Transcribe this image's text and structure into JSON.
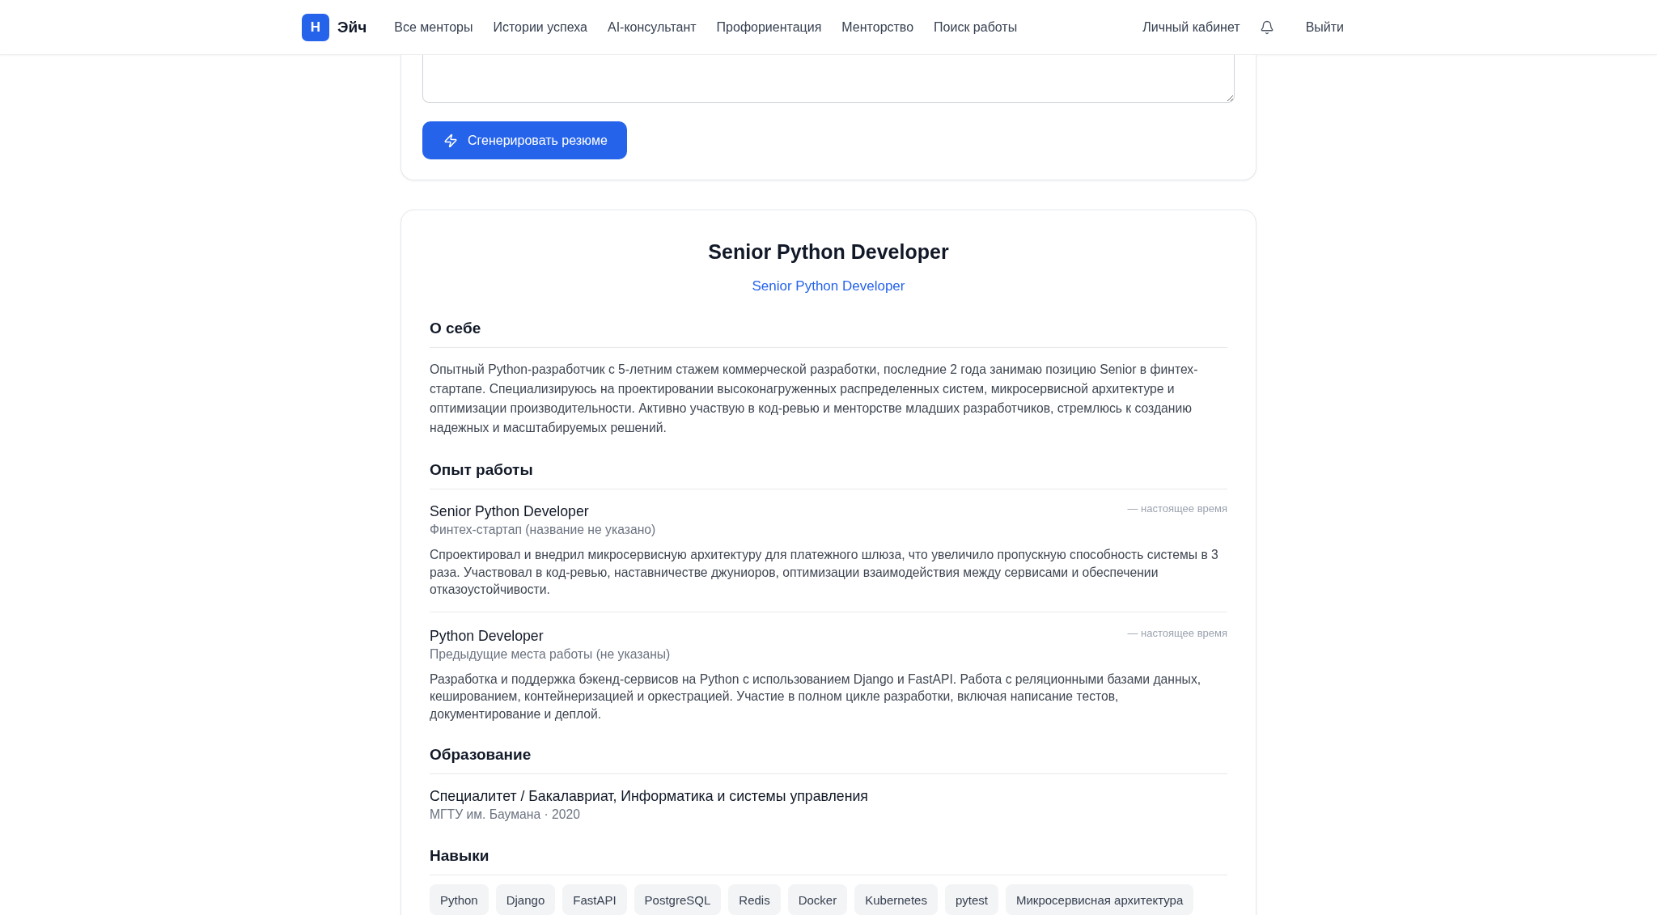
{
  "header": {
    "logo_mark": "H",
    "brand": "Эйч",
    "nav": [
      "Все менторы",
      "Истории успеха",
      "AI-консультант",
      "Профориентация",
      "Менторство",
      "Поиск работы"
    ],
    "account_link": "Личный кабинет",
    "logout": "Выйти"
  },
  "generator": {
    "button": "Сгенерировать резюме"
  },
  "resume": {
    "title": "Senior Python Developer",
    "subtitle": "Senior Python Developer",
    "sections": [
      {
        "kind": "about",
        "heading": "О себе",
        "text": "Опытный Python-разработчик с 5-летним стажем коммерческой разработки, последние 2 года занимаю позицию Senior в финтех-стартапе. Специализируюсь на проектировании высоконагруженных распределенных систем, микросервисной архитектуре и оптимизации производительности. Активно участвую в код-ревью и менторстве младших разработчиков, стремлюсь к созданию надежных и масштабируемых решений."
      },
      {
        "kind": "experience",
        "heading": "Опыт работы",
        "items": [
          {
            "position": "Senior Python Developer",
            "period": "— настоящее время",
            "company": "Финтех-стартап (название не указано)",
            "description": "Спроектировал и внедрил микросервисную архитектуру для платежного шлюза, что увеличило пропускную способность системы в 3 раза. Участвовал в код-ревью, наставничестве джуниоров, оптимизации взаимодействия между сервисами и обеспечении отказоустойчивости."
          },
          {
            "position": "Python Developer",
            "period": "— настоящее время",
            "company": "Предыдущие места работы (не указаны)",
            "description": "Разработка и поддержка бэкенд-сервисов на Python с использованием Django и FastAPI. Работа с реляционными базами данных, кешированием, контейнеризацией и оркестрацией. Участие в полном цикле разработки, включая написание тестов, документирование и деплой."
          }
        ]
      },
      {
        "kind": "education",
        "heading": "Образование",
        "items": [
          {
            "degree": "Специалитет / Бакалавриат, Информатика и системы управления",
            "details": "МГТУ им. Баумана · 2020"
          }
        ]
      },
      {
        "kind": "skills",
        "heading": "Навыки",
        "skills": [
          "Python",
          "Django",
          "FastAPI",
          "PostgreSQL",
          "Redis",
          "Docker",
          "Kubernetes",
          "pytest",
          "Микросервисная архитектура"
        ]
      }
    ]
  }
}
